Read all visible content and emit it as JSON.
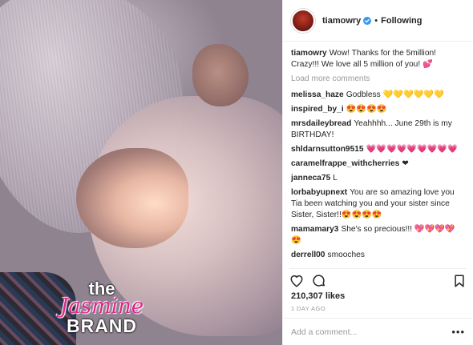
{
  "photo": {
    "watermark": {
      "line1": "the",
      "line2": "Jasmine",
      "line3": "BRAND"
    }
  },
  "header": {
    "username": "tiamowry",
    "separator": "•",
    "follow_label": "Following",
    "verified_color": "#3897f0"
  },
  "caption": {
    "username": "tiamowry",
    "text": "Wow! Thanks for the 5million! Crazy!!! We love all 5 million of you! 💕"
  },
  "load_more_label": "Load more comments",
  "comments": [
    {
      "username": "melissa_haze",
      "text": "Godbless 💛💛💛💛💛💛"
    },
    {
      "username": "inspired_by_i",
      "text": "😍😍😍😍"
    },
    {
      "username": "mrsdaileybread",
      "text": "Yeahhhh... June 29th is my BIRTHDAY!"
    },
    {
      "username": "shldarnsutton9515",
      "text": "💗💗💗💗💗💗💗💗💗"
    },
    {
      "username": "caramelfrappe_withcherries",
      "text": "❤"
    },
    {
      "username": "janneca75",
      "text": "L"
    },
    {
      "username": "lorbabyupnext",
      "text": "You are so amazing love you Tia been watching you and your sister since Sister, Sister!!😍😍😍😍"
    },
    {
      "username": "mamamary3",
      "text": "She's so precious!!! 💖💖💖💖😍"
    },
    {
      "username": "derrell00",
      "text": "smooches"
    }
  ],
  "likes": "210,307 likes",
  "timestamp": "1 DAY AGO",
  "add_comment_placeholder": "Add a comment...",
  "more_label": "•••",
  "icons": {
    "like": "heart-icon",
    "comment": "comment-icon",
    "save": "bookmark-icon",
    "verified": "verified-badge-icon",
    "more": "more-options-icon"
  }
}
